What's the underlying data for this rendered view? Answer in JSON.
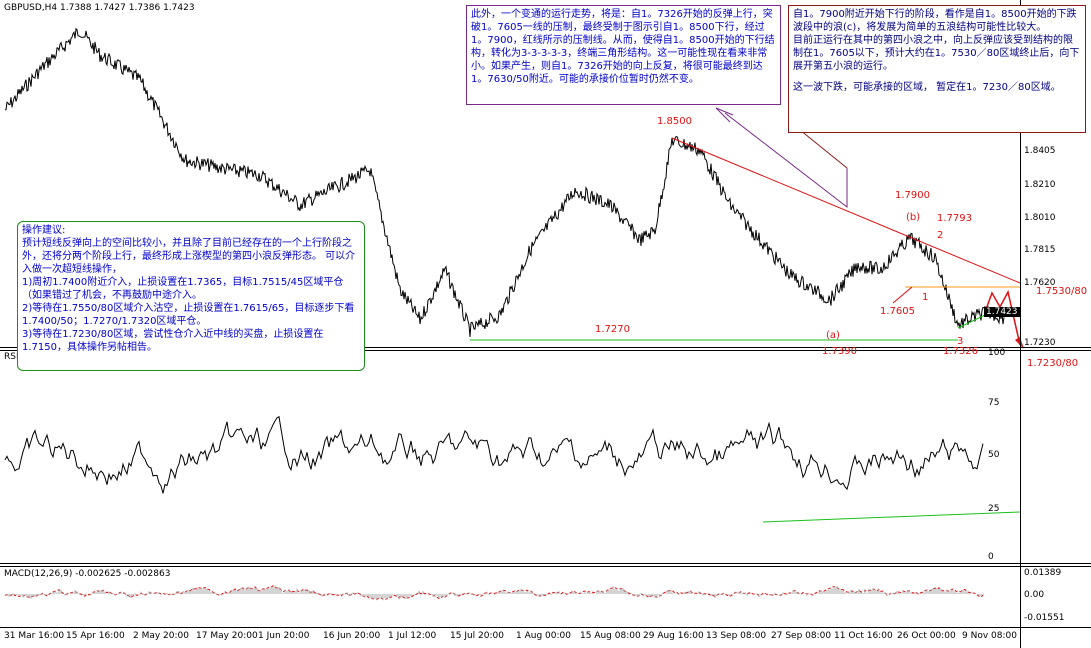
{
  "price_pane": {
    "header": "GBPUSD,H4  1.7388 1.7427 1.7386 1.7423",
    "price_axis": [
      "1.8405",
      "1.8210",
      "1.8010",
      "1.7815",
      "1.7620",
      "1.7425",
      "1.7230"
    ],
    "current_price": "1.7423",
    "labels": {
      "p1_8500": "1.8500",
      "p1_7900": "1.7900",
      "b_label": "(b)",
      "p1_7793": "1.7793",
      "n2": "2",
      "p1_7605": "1.7605",
      "n1": "1",
      "p1_7530": "1.7530/80",
      "p1_7270": "1.7270",
      "a_label": "(a)",
      "n3": "3",
      "p1_7390": "1.7390",
      "p1_7326": "1.7326",
      "p1_7230": "1.7230/80"
    }
  },
  "rsi_pane": {
    "header": "RSI",
    "axis": [
      "100",
      "75",
      "50",
      "25",
      "0"
    ]
  },
  "macd_pane": {
    "header": "MACD(12,26,9)  -0.002625  -0.002863",
    "axis": [
      "0.01389",
      "0.00",
      "-0.01551"
    ]
  },
  "dates": [
    "31 Mar 16:00",
    "15 Apr 16:00",
    "2 May 20:00",
    "17 May 20:00",
    "1 Jun 20:00",
    "16 Jun 20:00",
    "1 Jul 12:00",
    "15 Jul 20:00",
    "1 Aug 00:00",
    "15 Aug 08:00",
    "29 Aug 16:00",
    "13 Sep 08:00",
    "27 Sep 08:00",
    "11 Oct 16:00",
    "26 Oct 00:00",
    "9 Nov 08:00"
  ],
  "notes": {
    "green": [
      "操作建议:",
      "预计短线反弹向上的空间比较小，并且除了目前已经存在的一个上行阶段之外，还将分两个阶段上行，最终形成上涨楔型的第四小浪反弹形态。 可以介入做一次超短线操作，",
      "1)周初1.7400附近介入，止损设置在1.7365，目标1.7515/45区域平仓（如果错过了机会，不再鼓励中途介入。",
      "2)等待在1.7550/80区域介入沽空，止损设置在1.7615/65，目标逐步下看1.7400/50；1.7270/1.7320区域平仓。",
      "3)等待在1.7230/80区域，尝试性仓介入近中线的买盘，止损设置在1.7150，具体操作另帖相告。"
    ],
    "purple": [
      "此外，一个变通的运行走势，将是：自1。7326开始的反弹上行，突破1。7605一线的压制，最终受制于图示引自1。8500下行，经过1。7900，红线所示的压制线。从而，使得自1。8500开始的下行结构，转化为3-3-3-3-3，终端三角形结构。这一可能性现在看来非常小。如果产生，则自1。7326开始的向上反复，将很可能最终到达1。7630/50附近。可能的承接价位暂时仍然不变。"
    ],
    "red": [
      "自1。7900附近开始下行的阶段，看作是自1。8500开始的下跌波段中的浪(c)，将发展为简单的五浪结构可能性比较大。",
      "目前正运行在其中的第四小浪之中，向上反弹应该受到结构的限制在1。7605以下，预计大约在1。7530／80区域终止后，向下展开第五小浪的运行。",
      "这一波下跌，可能承接的区域， 暂定在1。7230／80区域。"
    ]
  }
}
